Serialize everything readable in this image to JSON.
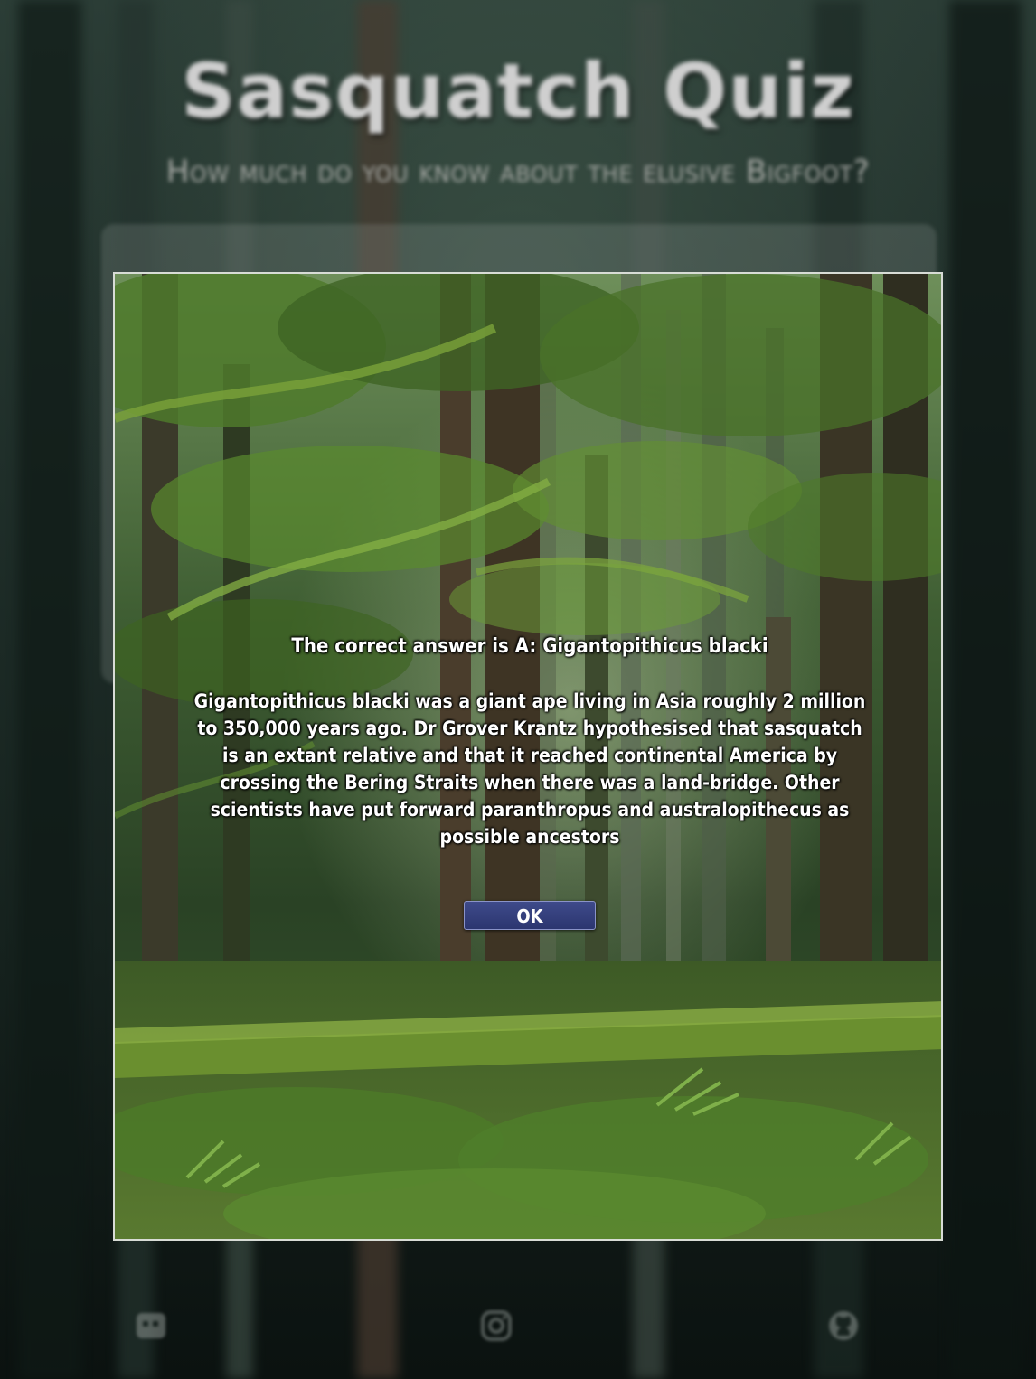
{
  "background": {
    "title": "Sasquatch Quiz",
    "subtitle": "How much do you know about the elusive Bigfoot?",
    "footer_icons": [
      "meetup-icon",
      "instagram-icon",
      "github-icon"
    ]
  },
  "modal": {
    "heading": "The correct answer is A: Gigantopithicus blacki",
    "explanation": "Gigantopithicus blacki was a giant ape living in Asia roughly 2 million to 350,000 years ago. Dr Grover Krantz hypothesised that sasquatch is an extant relative and that it reached continental America by crossing the Bering Straits when there was a land-bridge. Other scientists have put forward paranthropus and australopithecus as possible ancestors",
    "ok_label": "OK"
  },
  "colors": {
    "button_bg": "#2c3670",
    "modal_border": "#d8dcd6",
    "text": "#ffffff"
  }
}
